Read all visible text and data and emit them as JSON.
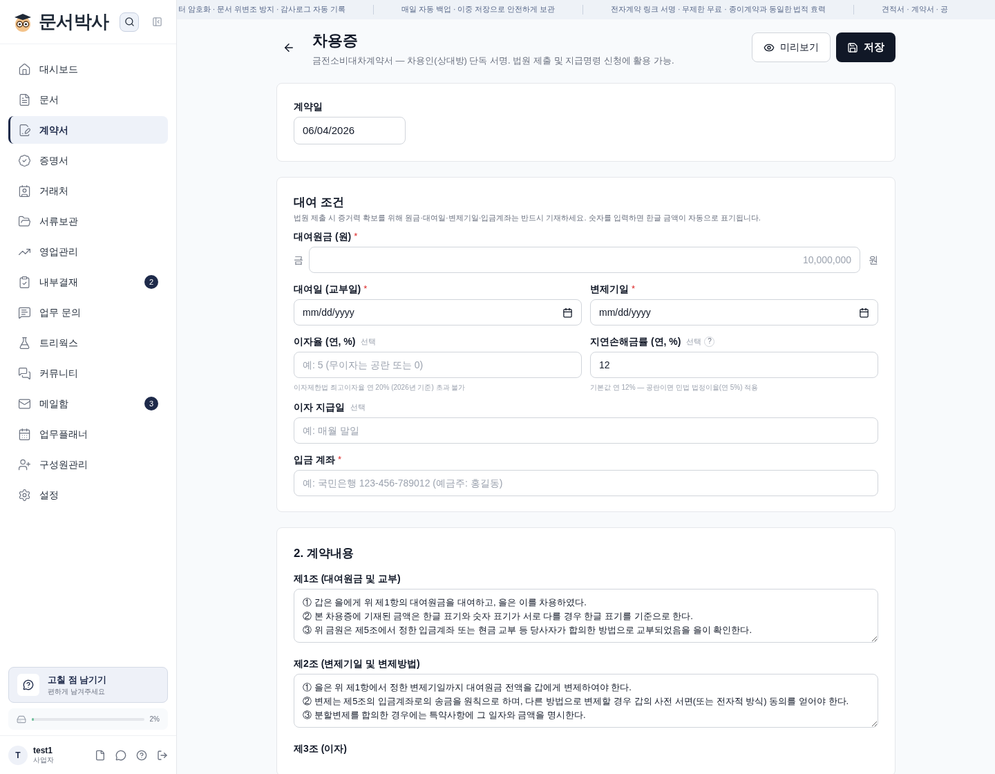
{
  "sidebar": {
    "logo": "문서박사",
    "items": [
      {
        "label": "대시보드",
        "selected": false
      },
      {
        "label": "문서",
        "selected": false
      },
      {
        "label": "계약서",
        "selected": true
      },
      {
        "label": "증명서",
        "selected": false
      },
      {
        "label": "거래처",
        "selected": false
      },
      {
        "label": "서류보관",
        "selected": false
      },
      {
        "label": "영업관리",
        "selected": false
      },
      {
        "label": "내부결재",
        "selected": false,
        "badge": "2"
      },
      {
        "label": "업무 문의",
        "selected": false
      },
      {
        "label": "트리웍스",
        "selected": false
      },
      {
        "label": "커뮤니티",
        "selected": false
      },
      {
        "label": "메일함",
        "selected": false,
        "badge": "3"
      },
      {
        "label": "업무플래너",
        "selected": false
      },
      {
        "label": "구성원관리",
        "selected": false
      },
      {
        "label": "설정",
        "selected": false
      }
    ],
    "feedback": {
      "title": "고칠 점 남기기",
      "subtitle": "편하게 남겨주세요"
    },
    "storage": {
      "level": 0.02,
      "reading": "2%"
    },
    "user": {
      "initial": "T",
      "name": "test1",
      "role": "사업자"
    }
  },
  "ticker": [
    "터 암호화 · 문서 위변조 방지 · 감사로그 자동 기록",
    "매일 자동 백업 · 이중 저장으로 안전하게 보관",
    "전자계약 링크 서명 · 무제한 무료 · 종이계약과 동일한 법적 효력",
    "견적서 · 계약서 · 공"
  ],
  "header": {
    "title": "차용증",
    "subtitle": "금전소비대차계약서 — 차용인(상대방) 단독 서명. 법원 제출 및 지급명령 신청에 활용 가능.",
    "preview_button": "미리보기",
    "save_button": "저장"
  },
  "contract_date": {
    "label": "계약일",
    "value": "06/04/2026"
  },
  "loan_terms": {
    "title": "대여 조건",
    "description": "법원 제출 시 증거력 확보를 위해 원금·대여일·변제기일·입금계좌는 반드시 기재하세요. 숫자를 입력하면 한글 금액이 자동으로 표기됩니다.",
    "principal": {
      "label": "대여원금 (원)",
      "required_mark": "*",
      "prefix": "금",
      "placeholder": "10,000,000",
      "suffix": "원"
    },
    "loan_date": {
      "label": "대여일 (교부일)",
      "required_mark": "*",
      "placeholder": "mm/dd/yyyy"
    },
    "due_date": {
      "label": "변제기일",
      "required_mark": "*",
      "placeholder": "mm/dd/yyyy"
    },
    "interest": {
      "label": "이자율 (연, %)",
      "optional": "선택",
      "placeholder": "예: 5 (무이자는 공란 또는 0)",
      "hint": "이자제한법 최고이자율 연 20% (2026년 기준) 초과 불가"
    },
    "late_rate": {
      "label": "지연손해금률 (연, %)",
      "optional": "선택",
      "help": "?",
      "value": "12",
      "hint": "기본값 연 12% — 공란이면 민법 법정이율(연 5%) 적용"
    },
    "interest_day": {
      "label": "이자 지급일",
      "optional": "선택",
      "placeholder": "예: 매월 말일"
    },
    "account": {
      "label": "입금 계좌",
      "required_mark": "*",
      "placeholder": "예: 국민은행 123-456-789012 (예금주: 홍길동)"
    }
  },
  "contents": {
    "title": "2. 계약내용",
    "articles": [
      {
        "label": "제1조 (대여원금 및 교부)",
        "text": "① 갑은 을에게 위 제1항의 대여원금을 대여하고, 을은 이를 차용하였다.\n② 본 차용증에 기재된 금액은 한글 표기와 숫자 표기가 서로 다를 경우 한글 표기를 기준으로 한다.\n③ 위 금원은 제5조에서 정한 입금계좌 또는 현금 교부 등 당사자가 합의한 방법으로 교부되었음을 을이 확인한다."
      },
      {
        "label": "제2조 (변제기일 및 변제방법)",
        "text": "① 을은 위 제1항에서 정한 변제기일까지 대여원금 전액을 갑에게 변제하여야 한다.\n② 변제는 제5조의 입금계좌로의 송금을 원칙으로 하며, 다른 방법으로 변제할 경우 갑의 사전 서면(또는 전자적 방식) 동의를 얻어야 한다.\n③ 분할변제를 합의한 경우에는 특약사항에 그 일자와 금액을 명시한다."
      },
      {
        "label": "제3조 (이자)"
      }
    ]
  }
}
